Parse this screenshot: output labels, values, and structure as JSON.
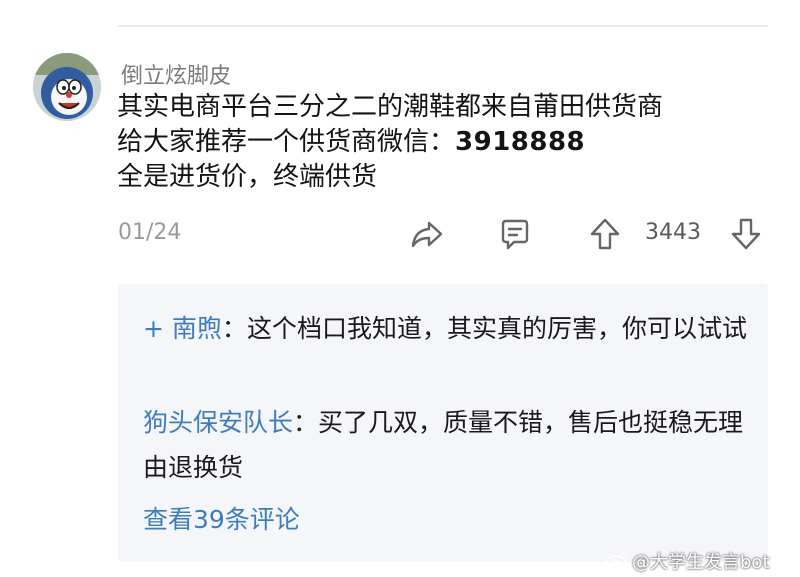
{
  "comment": {
    "username": "倒立炫脚皮",
    "text_line1": "其实电商平台三分之二的潮鞋都来自莆田供货商",
    "text_line2_prefix": "给大家推荐一个供货商微信：",
    "text_line2_wechat": "3918888",
    "text_line3": "全是进货价，终端供货",
    "date": "01/24",
    "vote_count": "3443"
  },
  "replies": [
    {
      "prefix": "+ ",
      "author": "南煦",
      "colon": "：",
      "text": "这个档口我知道，其实真的厉害，你可以试试"
    },
    {
      "prefix": "",
      "author": "狗头保安队长",
      "colon": "：",
      "text": "买了几双，质量不错，售后也挺稳无理由退换货"
    }
  ],
  "view_more": "查看39条评论",
  "watermark": "@大学生发言bot",
  "icons": [
    "share-icon",
    "reply-icon",
    "upvote-icon",
    "downvote-icon",
    "weibo-icon"
  ],
  "colors": {
    "link": "#3d7dbb",
    "muted": "#9a9a9a",
    "reply_bg": "#f5f6fa"
  }
}
